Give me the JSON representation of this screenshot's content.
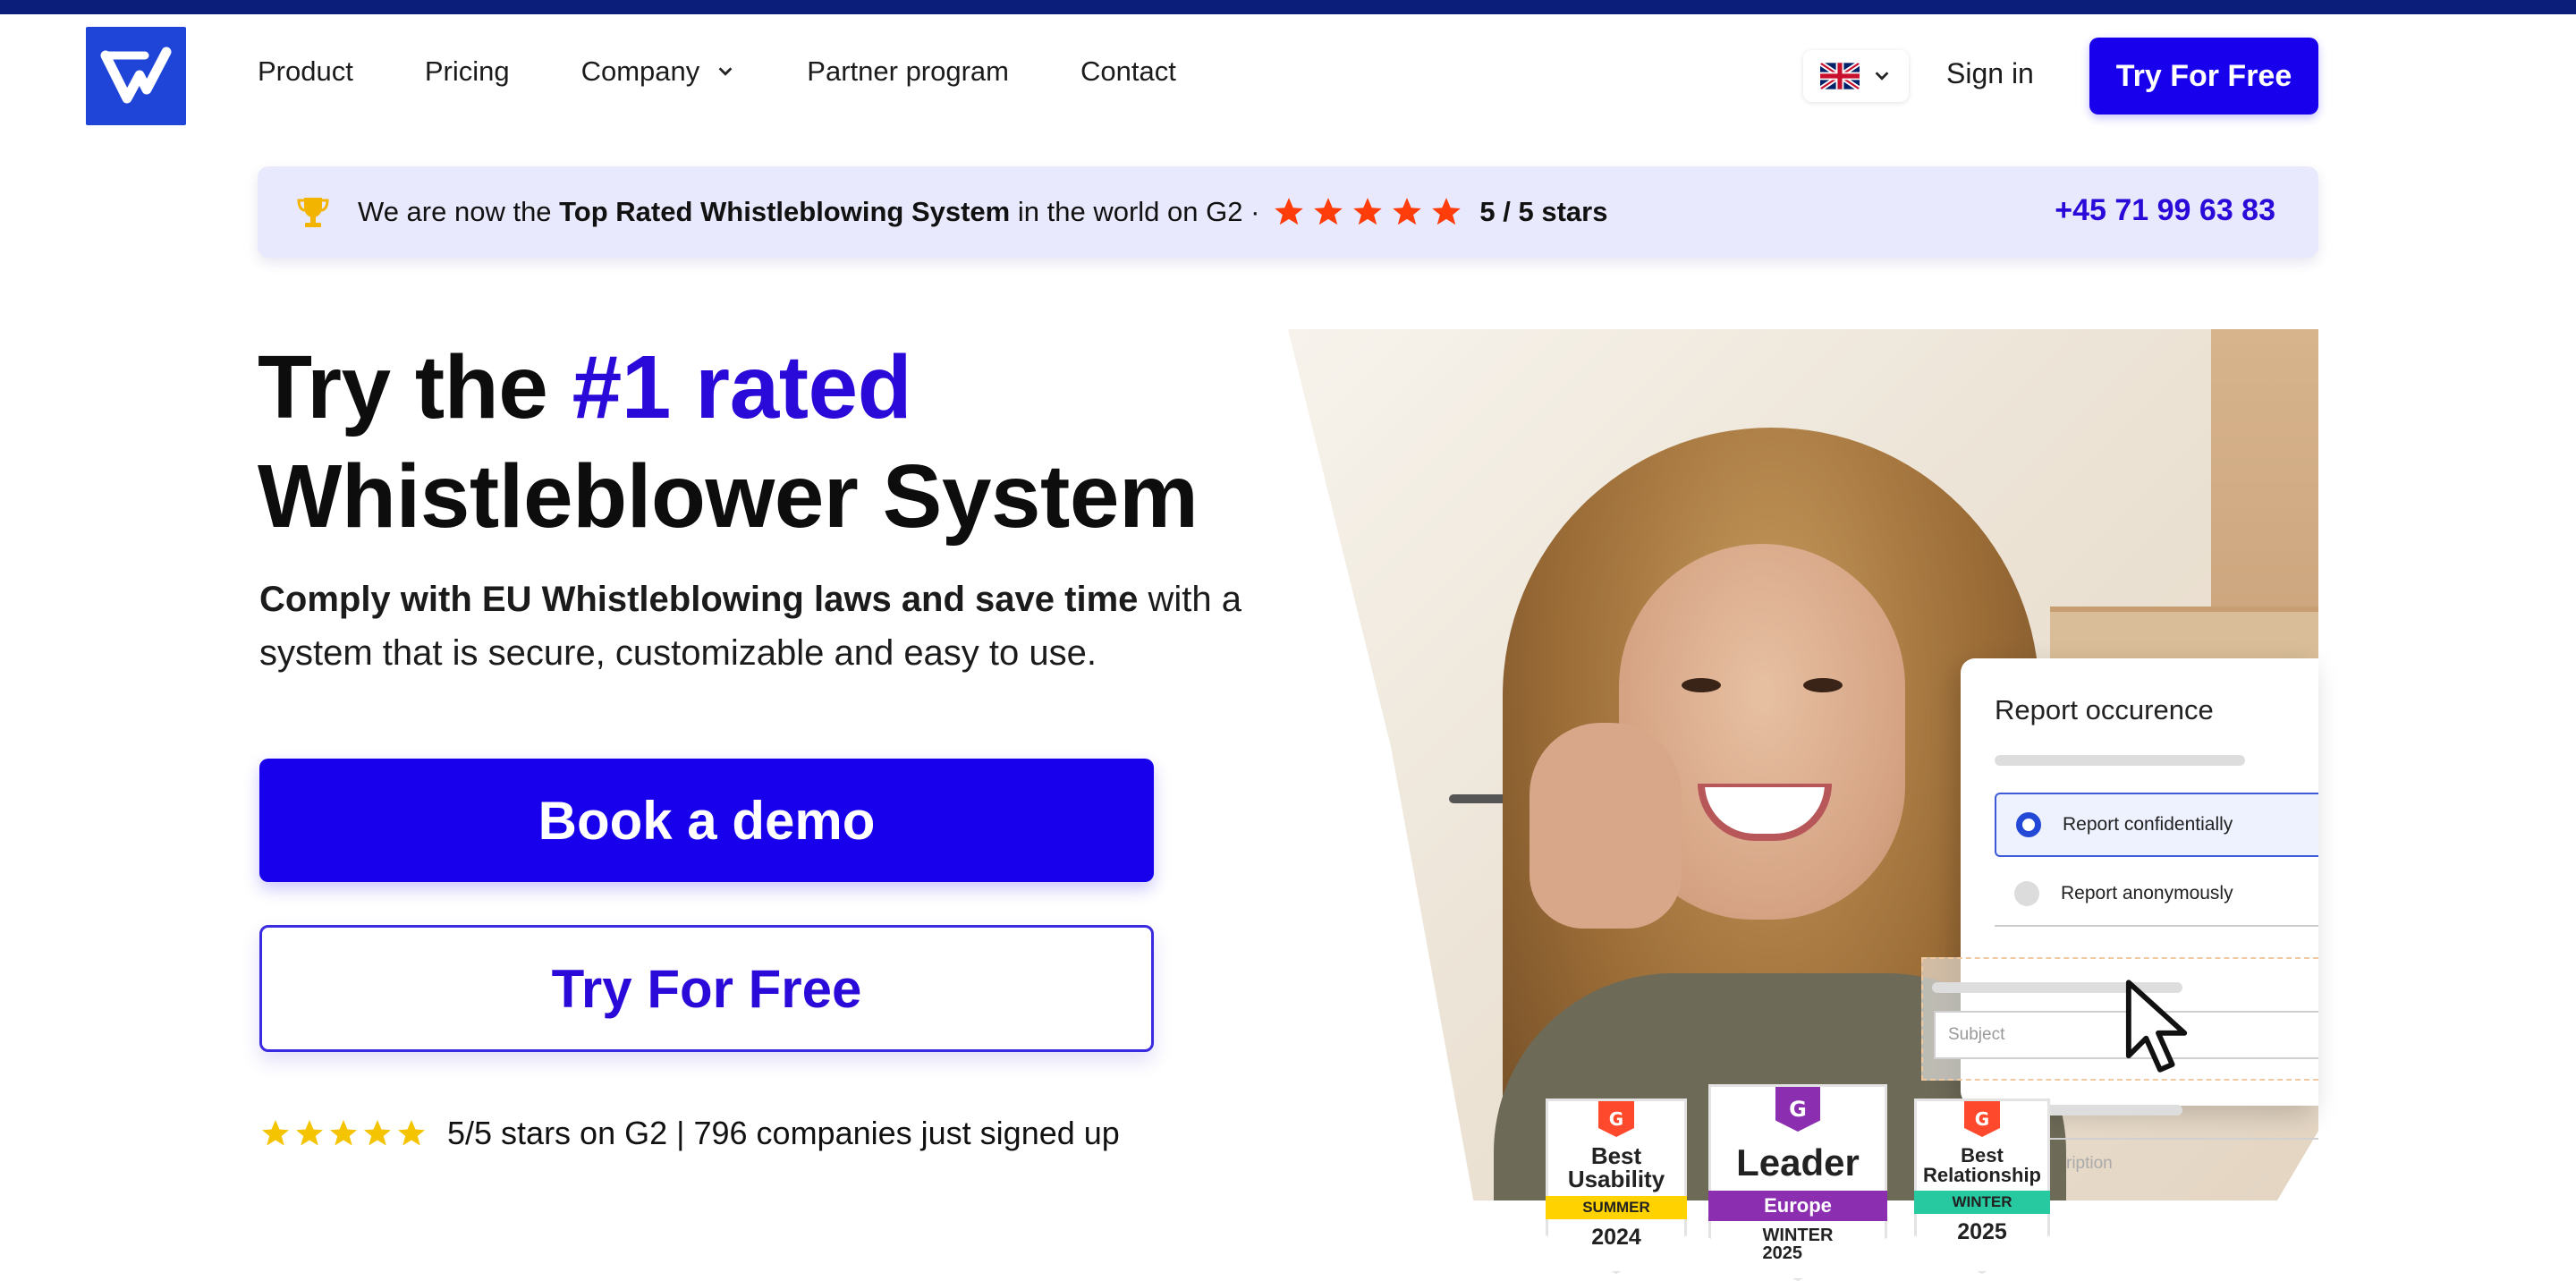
{
  "nav": {
    "items": [
      "Product",
      "Pricing",
      "Company",
      "Partner program",
      "Contact"
    ],
    "sign_in": "Sign in",
    "try_free": "Try For Free",
    "language_flag": "uk-flag-icon"
  },
  "announcement": {
    "prefix": "We are now the",
    "highlight": "Top Rated Whistleblowing System",
    "suffix": "in the world on G2 ·",
    "rating": "5 / 5 stars",
    "phone": "+45 71 99 63 83",
    "star_color": "#ff3d0a"
  },
  "hero": {
    "title_1": "Try the ",
    "title_accent": "#1 rated",
    "title_2": "Whistleblower System",
    "subtitle_bold": "Comply with EU Whistleblowing laws and save time",
    "subtitle_rest": " with a system that is secure, customizable and easy to use.",
    "book_demo": "Book a demo",
    "try_free": "Try For Free",
    "g2_text": "5/5 stars on G2 | 796 companies just signed up",
    "accent_color": "#1800ec"
  },
  "report_card": {
    "title": "Report occurence",
    "option_1": "Report confidentially",
    "option_2": "Report anonymously",
    "subject_placeholder": "Subject",
    "description_placeholder": "ription"
  },
  "badges": [
    {
      "name_line1": "Best",
      "name_line2": "Usability",
      "ribbon": "SUMMER",
      "year": "2024",
      "ribbon_color": "#ffd200"
    },
    {
      "name_line1": "Leader",
      "name_line2": "",
      "ribbon": "Europe",
      "year_line1": "WINTER",
      "year_line2": "2025",
      "ribbon_color": "#8b2fb0"
    },
    {
      "name_line1": "Best",
      "name_line2": "Relationship",
      "ribbon": "WINTER",
      "year": "2025",
      "ribbon_color": "#27c9a0"
    }
  ]
}
